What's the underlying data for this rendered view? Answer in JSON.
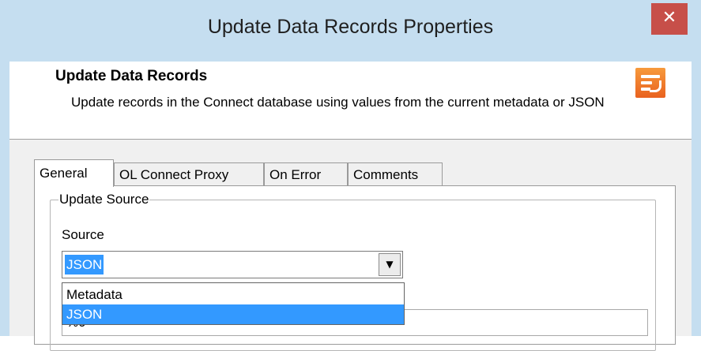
{
  "window": {
    "title": "Update Data Records Properties",
    "close_symbol": "✕"
  },
  "header": {
    "title": "Update Data Records",
    "description": "Update records in the Connect database using values from the current metadata or JSON",
    "icon": "update-records-icon"
  },
  "tabs": [
    {
      "label": "General",
      "active": true
    },
    {
      "label": "OL Connect Proxy",
      "active": false
    },
    {
      "label": "On Error",
      "active": false
    },
    {
      "label": "Comments",
      "active": false
    }
  ],
  "general": {
    "group_label": "Update Source",
    "source_label": "Source",
    "source_value": "JSON",
    "source_options": [
      {
        "label": "Metadata",
        "selected": false
      },
      {
        "label": "JSON",
        "selected": true
      }
    ],
    "field_behind_text": "%0"
  },
  "colors": {
    "selection": "#3399ff",
    "close": "#c74f49",
    "icon_orange": "#ef7a2c"
  }
}
